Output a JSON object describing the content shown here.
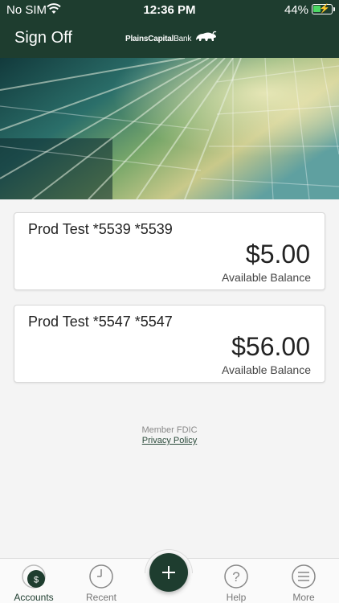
{
  "status_bar": {
    "carrier": "No SIM",
    "time": "12:36 PM",
    "battery": "44%",
    "battery_level": 0.44
  },
  "nav": {
    "sign_off_label": "Sign Off",
    "logo_text_bold": "PlainsCapital",
    "logo_text_light": "Bank"
  },
  "accounts": [
    {
      "name": "Prod Test *5539 *5539",
      "amount": "$5.00",
      "balance_label": "Available Balance"
    },
    {
      "name": "Prod Test *5547 *5547",
      "amount": "$56.00",
      "balance_label": "Available Balance"
    }
  ],
  "footer": {
    "member_fdic": "Member FDIC",
    "privacy_policy": "Privacy Policy"
  },
  "tabs": [
    {
      "label": "Accounts",
      "icon": "accounts-icon",
      "active": true
    },
    {
      "label": "Recent",
      "icon": "clock-icon",
      "active": false
    },
    {
      "label": "",
      "icon": "plus-icon",
      "active": false
    },
    {
      "label": "Help",
      "icon": "help-icon",
      "active": false
    },
    {
      "label": "More",
      "icon": "menu-icon",
      "active": false
    }
  ],
  "colors": {
    "brand": "#1e3d2f",
    "background": "#f4f4f4"
  }
}
